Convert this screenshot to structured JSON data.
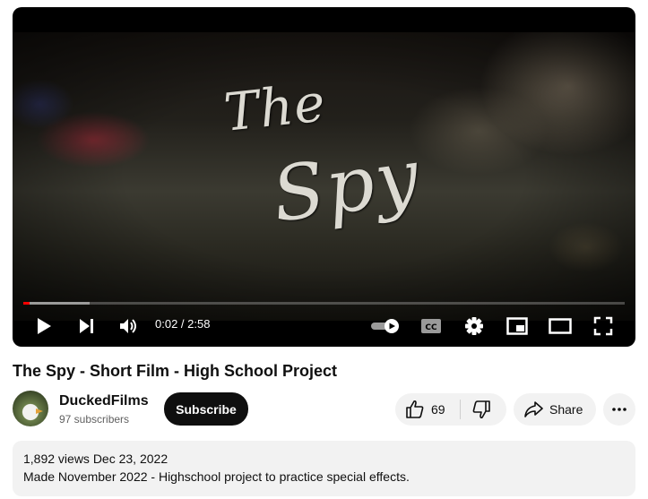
{
  "video": {
    "title_art_line1": "The",
    "title_art_line2": "Spy",
    "progress": 0.011,
    "buffered": 0.11,
    "time_display": "0:02 / 2:58"
  },
  "controls": {
    "play_icon": "play-icon",
    "next_icon": "next-icon",
    "volume_icon": "volume-icon",
    "autoplay_icon": "autoplay-toggle-icon",
    "cc_label": "CC",
    "settings_icon": "gear-icon",
    "miniplayer_icon": "miniplayer-icon",
    "theater_icon": "theater-mode-icon",
    "fullscreen_icon": "fullscreen-icon",
    "progress_color": "#ff0000"
  },
  "title": "The Spy - Short Film - High School Project",
  "channel": {
    "name": "DuckedFilms",
    "subscribers": "97 subscribers",
    "subscribe_label": "Subscribe"
  },
  "actions": {
    "like_count": "69",
    "share_label": "Share"
  },
  "description": {
    "meta": "1,892 views  Dec 23, 2022",
    "text": "Made November 2022 - Highschool project to practice special effects."
  }
}
